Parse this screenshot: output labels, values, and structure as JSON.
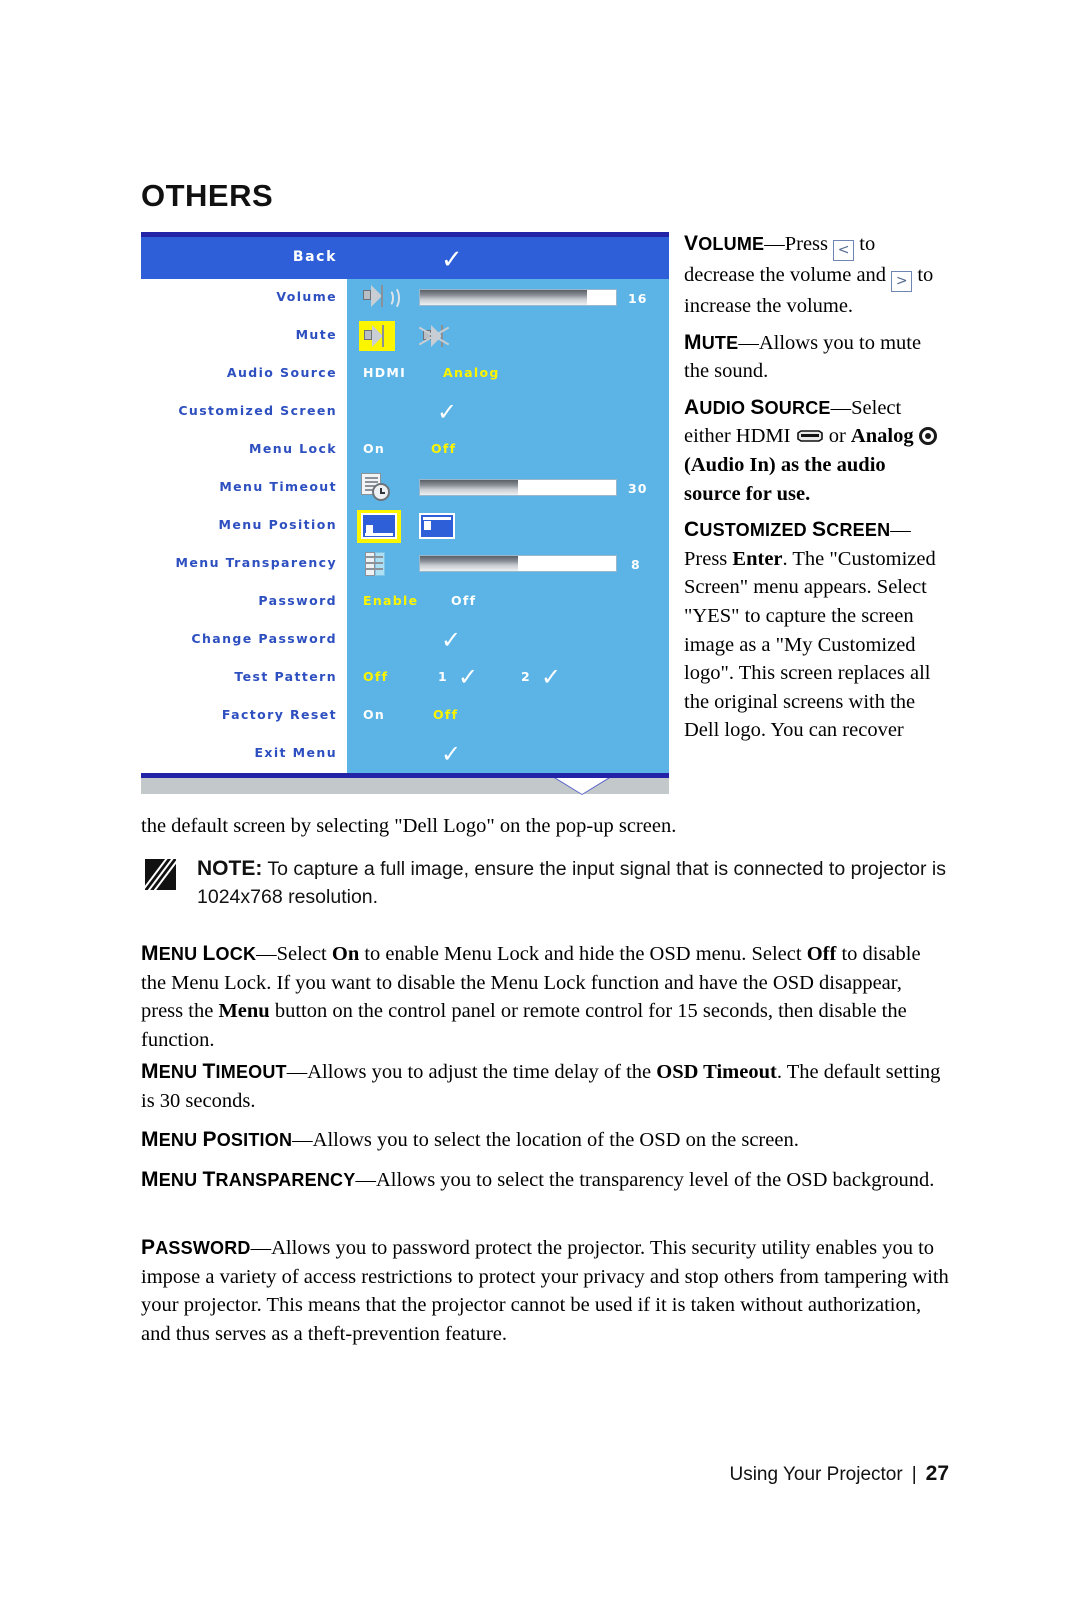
{
  "page": {
    "section_title": "OTHERS",
    "footer_text": "Using Your Projector",
    "footer_sep": "|",
    "page_number": "27"
  },
  "colors": {
    "osd_header_blue": "#2f5fd8",
    "osd_border_blue": "#2323a8",
    "osd_panel_blue": "#5bb4e5",
    "osd_label_blue": "#2d4fc0",
    "osd_highlight_yellow": "#fcf500",
    "osd_footer_gray": "#c3c8cb"
  },
  "osd": {
    "header": {
      "label": "Back",
      "icon": "checkmark-icon",
      "check": "✓"
    },
    "rows": [
      {
        "label": "Volume",
        "type": "slider",
        "icon": "speaker-icon",
        "value": "16",
        "fill_percent": 85
      },
      {
        "label": "Mute",
        "type": "toggle-icons",
        "icons": [
          "speaker-on-icon",
          "speaker-muted-icon"
        ],
        "selected_index": 0
      },
      {
        "label": "Audio Source",
        "type": "options",
        "options": [
          "HDMI",
          "Analog"
        ],
        "selected": "Analog"
      },
      {
        "label": "Customized Screen",
        "type": "action",
        "icon": "checkmark-icon",
        "check": "✓"
      },
      {
        "label": "Menu Lock",
        "type": "options",
        "options": [
          "On",
          "Off"
        ],
        "selected": "Off"
      },
      {
        "label": "Menu Timeout",
        "type": "slider",
        "icon": "document-clock-icon",
        "value": "30",
        "fill_percent": 50
      },
      {
        "label": "Menu Position",
        "type": "position-icons",
        "icons": [
          "menu-position-bottom-left-icon",
          "menu-position-top-left-icon"
        ],
        "selected_index": 0
      },
      {
        "label": "Menu Transparency",
        "type": "slider",
        "icon": "transparency-icon",
        "value": "8",
        "fill_percent": 50
      },
      {
        "label": "Password",
        "type": "options",
        "options": [
          "Enable",
          "Off"
        ],
        "selected": "Enable"
      },
      {
        "label": "Change Password",
        "type": "action",
        "icon": "checkmark-icon",
        "check": "✓"
      },
      {
        "label": "Test Pattern",
        "type": "options-with-checks",
        "options": [
          "Off",
          "1",
          "2"
        ],
        "selected": "Off",
        "check": "✓"
      },
      {
        "label": "Factory Reset",
        "type": "options",
        "options": [
          "On",
          "Off"
        ],
        "selected": "Off"
      },
      {
        "label": "Exit Menu",
        "type": "action",
        "icon": "checkmark-icon",
        "check": "✓"
      }
    ],
    "scroll_indicator": "down-arrow-icon"
  },
  "right_column": {
    "volume": {
      "term": "VOLUME",
      "dash": "—",
      "text_1": "Press",
      "key_left": "<",
      "text_2": "to decrease the volume and",
      "key_right": ">",
      "text_3": "to increase the volume."
    },
    "mute": {
      "term": "MUTE",
      "dash": "—",
      "text": "Allows you to mute the sound."
    },
    "audio_source": {
      "term": "AUDIO SOURCE",
      "dash": "—",
      "text_1": "Select either",
      "hdmi_label": "HDMI",
      "text_2": "or",
      "analog_label": "Analog",
      "text_3": "(Audio In) as the audio source for use."
    },
    "customized_screen": {
      "term": "CUSTOMIZED SCREEN",
      "dash": "—",
      "text_1": "Press",
      "enter_label": "Enter",
      "text_2": ". The \"Customized Screen\" menu appears. Select \"YES\" to capture the screen image as a \"My Customized logo\". This screen replaces all the original screens with the Dell logo. You can recover"
    }
  },
  "paragraphs": {
    "wrap_line": "the default screen by selecting \"Dell Logo\" on the pop-up screen.",
    "note": {
      "label": "NOTE:",
      "text": "To capture a full image, ensure the input signal that is connected to projector is 1024x768 resolution."
    },
    "menu_lock": {
      "term": "MENU LOCK",
      "dash": "—",
      "part_1": "Select",
      "bold_on": "On",
      "part_2": "to enable Menu Lock and hide the OSD menu. Select",
      "bold_off": "Off",
      "part_3": "to disable the Menu Lock. If you want to disable the Menu Lock function and have the OSD disappear, press the",
      "bold_menu": "Menu",
      "part_4": "button on the control panel or remote control for 15 seconds, then disable the function."
    },
    "menu_timeout": {
      "term": "MENU TIMEOUT",
      "dash": "—",
      "part_1": "Allows you to adjust the time delay of the",
      "bold_osd": "OSD Timeout",
      "part_2": ". The default setting is 30 seconds."
    },
    "menu_position": {
      "term": "MENU POSITION",
      "dash": "—",
      "text": "Allows you to select the location of the OSD on the screen."
    },
    "menu_transparency": {
      "term": "MENU TRANSPARENCY",
      "dash": "—",
      "text": "Allows you to select the transparency level of the OSD background."
    },
    "password": {
      "term": "PASSWORD",
      "dash": "—",
      "text": "Allows you to password protect the projector. This security utility enables you to impose a variety of access restrictions to protect your privacy and stop others from tampering with your projector. This means that the projector cannot be used if it is taken without authorization, and thus serves as a theft-prevention feature."
    }
  }
}
